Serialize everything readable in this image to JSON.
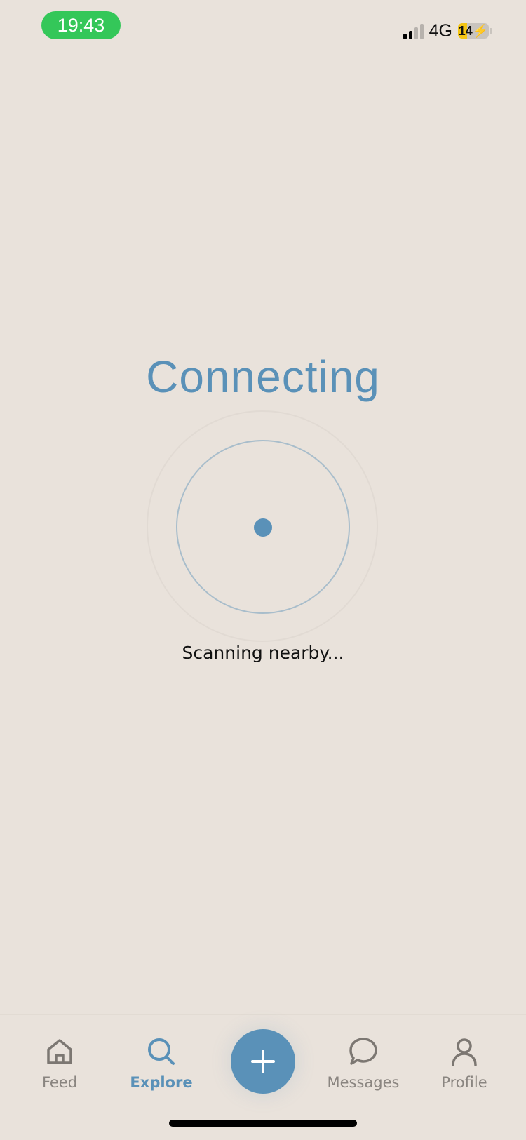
{
  "status_bar": {
    "time": "19:43",
    "network": "4G",
    "battery_level": "14",
    "battery_fraction": 0.14,
    "signal_bars_active": 2,
    "time_pill_color": "#34C759",
    "battery_color": "#F4C514"
  },
  "main": {
    "title": "Connecting",
    "subtitle": "Scanning nearby..."
  },
  "tabbar": {
    "items": [
      {
        "label": "Feed",
        "icon": "home-icon",
        "active": false
      },
      {
        "label": "Explore",
        "icon": "search-icon",
        "active": true
      },
      {
        "label": "Messages",
        "icon": "chat-bubble-icon",
        "active": false
      },
      {
        "label": "Profile",
        "icon": "person-icon",
        "active": false
      }
    ],
    "fab_icon": "plus-icon"
  },
  "colors": {
    "accent": "#5A91B8",
    "background": "#E9E2DB",
    "inactive": "#8A8580",
    "text": "#111111"
  }
}
